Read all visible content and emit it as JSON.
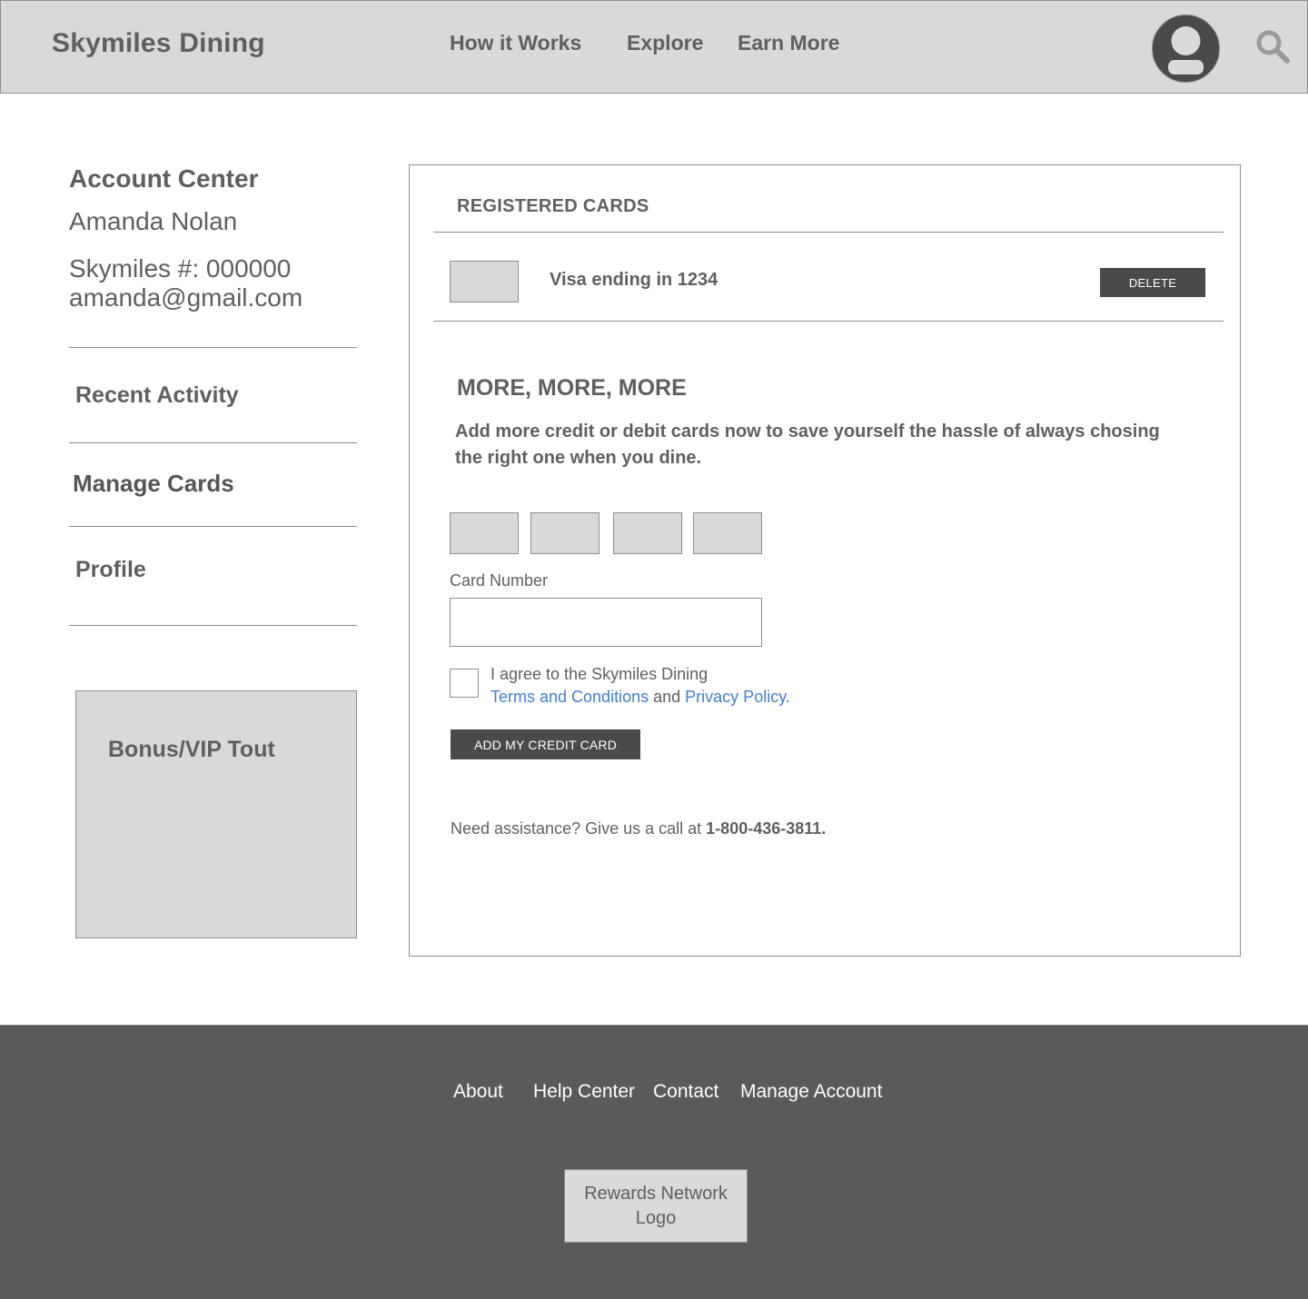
{
  "header": {
    "brand": "Skymiles Dining",
    "nav": [
      "How it Works",
      "Explore",
      "Earn More"
    ],
    "avatar_icon": "user-avatar-icon",
    "search_icon": "magnifier-icon"
  },
  "sidebar": {
    "title": "Account Center",
    "name": "Amanda Nolan",
    "skymiles_number": "Skymiles #: 000000",
    "email": "amanda@gmail.com",
    "items": [
      "Recent Activity",
      "Manage Cards",
      "Profile"
    ],
    "active_item": "Manage Cards",
    "tout": "Bonus/VIP Tout"
  },
  "registered": {
    "title": "REGISTERED CARDS",
    "card_label": "Visa ending in 1234",
    "delete_label": "DELETE"
  },
  "add_card": {
    "title": "MORE, MORE, MORE",
    "description": "Add more credit or debit cards now to save yourself the hassle of always chosing the right one when you dine.",
    "card_number_label": "Card Number",
    "card_number_value": "",
    "agree_prefix": "I agree to the Skymiles Dining",
    "terms_link": "Terms and Conditions",
    "and_text": "and",
    "privacy_link": "Privacy Policy.",
    "add_button": "ADD MY CREDIT CARD",
    "assist_text": "Need assistance? Give us a call at",
    "phone": "1-800-436-3811."
  },
  "footer": {
    "links": [
      "About",
      "Help Center",
      "Contact",
      "Manage Account"
    ],
    "logo": "Rewards Network Logo"
  },
  "colors": {
    "header_bg": "#d9d9d9",
    "footer_bg": "#5a5a5a",
    "button_bg": "#4a4a4a",
    "link": "#3f7fd0"
  }
}
